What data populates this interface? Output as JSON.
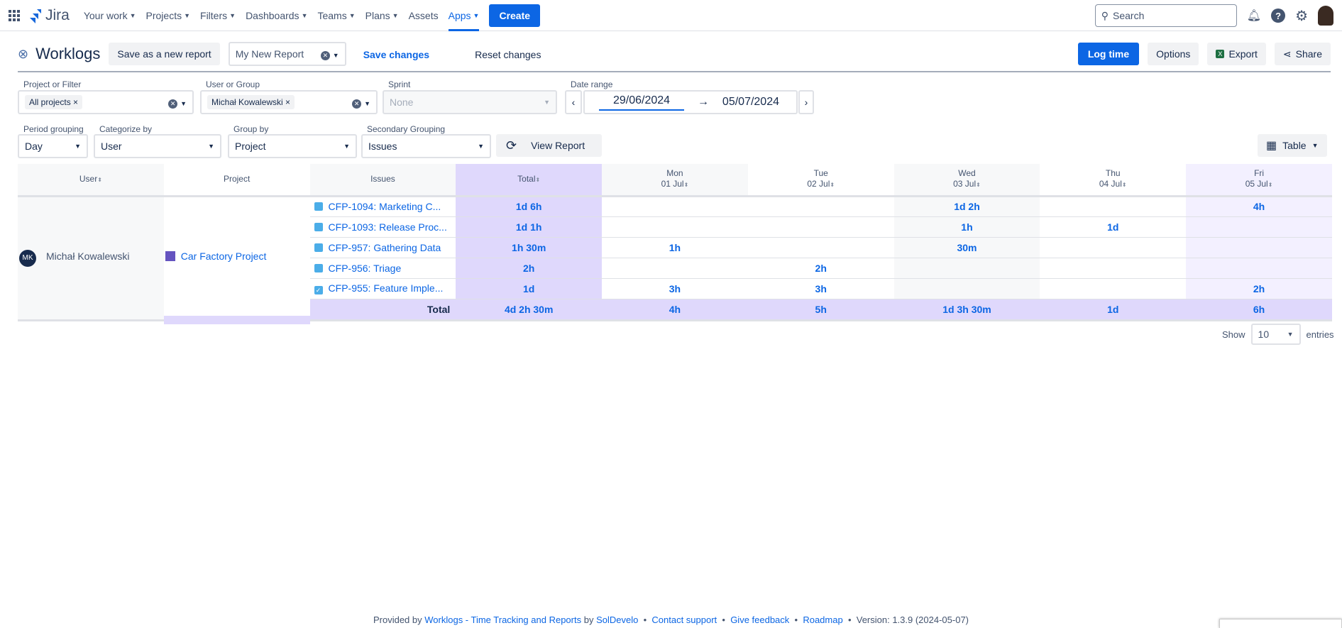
{
  "topnav": {
    "logo": "Jira",
    "items": [
      {
        "label": "Your work",
        "chevron": true
      },
      {
        "label": "Projects",
        "chevron": true
      },
      {
        "label": "Filters",
        "chevron": true
      },
      {
        "label": "Dashboards",
        "chevron": true
      },
      {
        "label": "Teams",
        "chevron": true
      },
      {
        "label": "Plans",
        "chevron": true
      },
      {
        "label": "Assets",
        "chevron": false
      },
      {
        "label": "Apps",
        "chevron": true,
        "active": true
      }
    ],
    "create": "Create",
    "search_placeholder": "Search"
  },
  "header": {
    "title": "Worklogs",
    "save_new": "Save as a new report",
    "report_name": "My New Report",
    "save_changes": "Save changes",
    "reset_changes": "Reset changes",
    "log_time": "Log time",
    "options": "Options",
    "export": "Export",
    "share": "Share"
  },
  "filters": {
    "project_label": "Project or Filter",
    "project_tag": "All projects",
    "user_label": "User or Group",
    "user_tag": "Michał Kowalewski",
    "sprint_label": "Sprint",
    "sprint_placeholder": "None",
    "date_label": "Date range",
    "date_from": "29/06/2024",
    "date_to": "05/07/2024",
    "period_label": "Period grouping",
    "period": "Day",
    "categorize_label": "Categorize by",
    "categorize": "User",
    "group_label": "Group by",
    "group": "Project",
    "secondary_label": "Secondary Grouping",
    "secondary": "Issues",
    "view_report": "View Report",
    "view_mode": "Table"
  },
  "table": {
    "headers": {
      "user": "User",
      "project": "Project",
      "issues": "Issues",
      "total": "Total"
    },
    "days": [
      {
        "day": "Mon",
        "date": "01 Jul"
      },
      {
        "day": "Tue",
        "date": "02 Jul"
      },
      {
        "day": "Wed",
        "date": "03 Jul"
      },
      {
        "day": "Thu",
        "date": "04 Jul"
      },
      {
        "day": "Fri",
        "date": "05 Jul"
      }
    ],
    "user": {
      "initials": "MK",
      "name": "Michał Kowalewski"
    },
    "project": "Car Factory Project",
    "rows": [
      {
        "issue": "CFP-1094: Marketing C...",
        "type": "story",
        "total": "1d 6h",
        "days": [
          "",
          "",
          "1d 2h",
          "",
          "4h"
        ]
      },
      {
        "issue": "CFP-1093: Release Proc...",
        "type": "story",
        "total": "1d 1h",
        "days": [
          "",
          "",
          "1h",
          "1d",
          ""
        ]
      },
      {
        "issue": "CFP-957: Gathering Data",
        "type": "story",
        "total": "1h 30m",
        "days": [
          "1h",
          "",
          "30m",
          "",
          ""
        ]
      },
      {
        "issue": "CFP-956: Triage",
        "type": "story",
        "total": "2h",
        "days": [
          "",
          "2h",
          "",
          "",
          ""
        ]
      },
      {
        "issue": "CFP-955: Feature Imple...",
        "type": "task",
        "total": "1d",
        "days": [
          "3h",
          "3h",
          "",
          "",
          "2h"
        ]
      }
    ],
    "total_row": {
      "label": "Total",
      "total": "4d 2h 30m",
      "days": [
        "4h",
        "5h",
        "1d 3h 30m",
        "1d",
        "6h"
      ]
    }
  },
  "pagination": {
    "show": "Show",
    "value": "10",
    "entries": "entries"
  },
  "footer": {
    "provided_by": "Provided by",
    "app_link": "Worklogs - Time Tracking and Reports",
    "by": "by",
    "vendor": "SolDevelo",
    "contact": "Contact support",
    "feedback": "Give feedback",
    "roadmap": "Roadmap",
    "version": "Version: 1.3.9 (2024-05-07)",
    "sep": "•"
  }
}
